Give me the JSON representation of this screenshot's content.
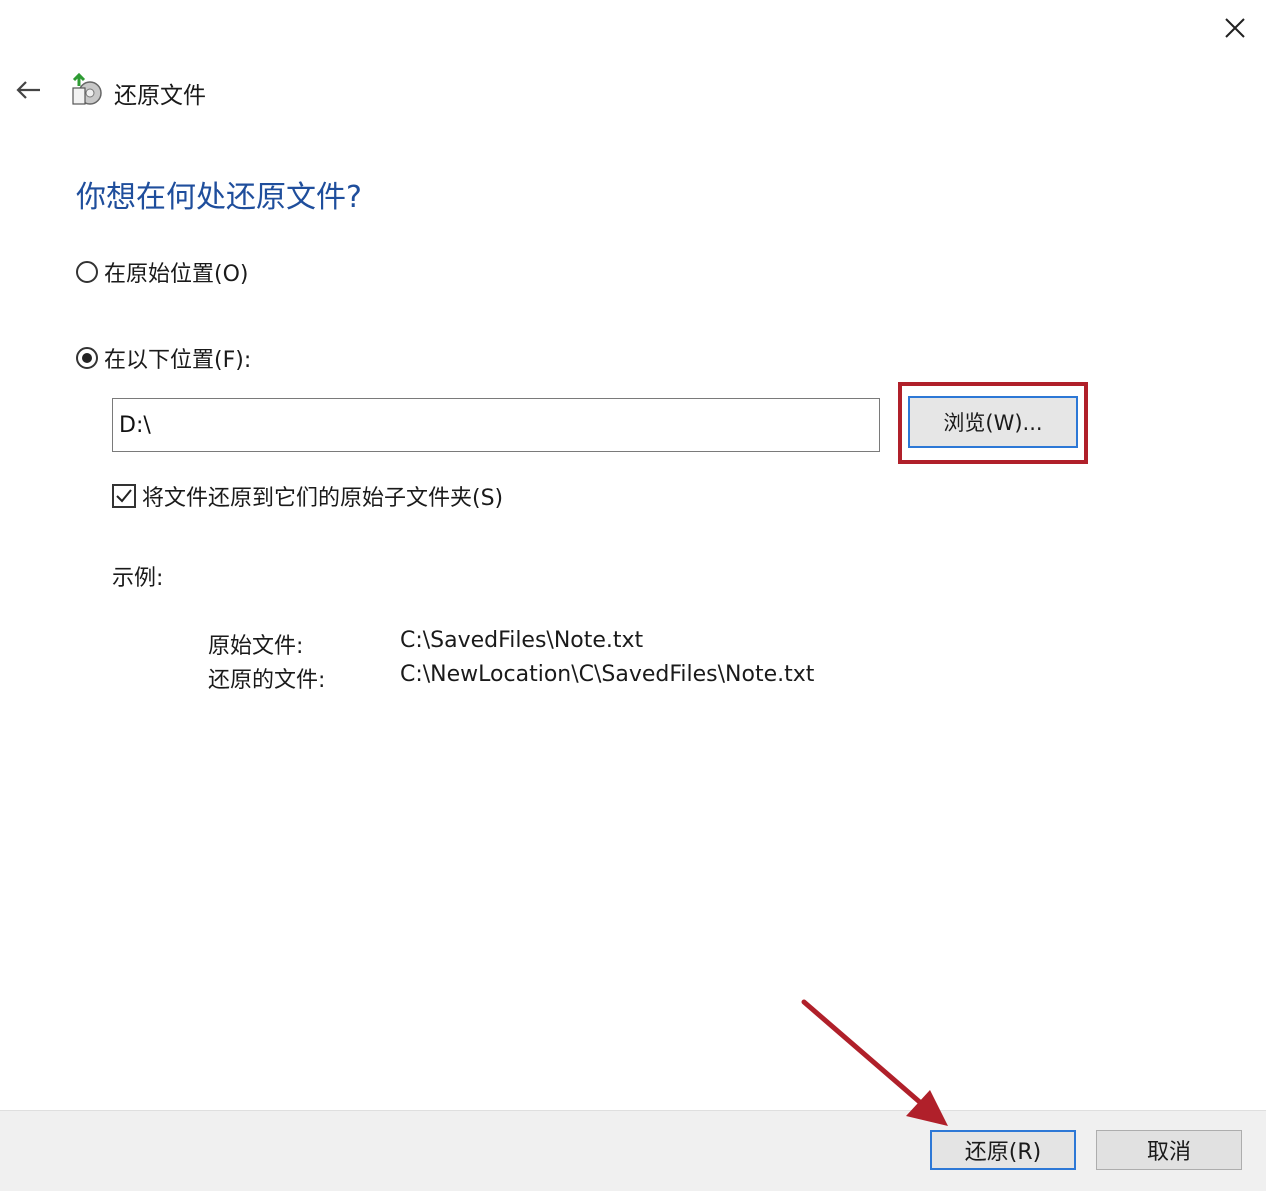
{
  "window": {
    "title": "还原文件"
  },
  "heading": "你想在何处还原文件?",
  "options": {
    "original_location": {
      "label": "在原始位置(O)",
      "selected": false
    },
    "following_location": {
      "label": "在以下位置(F):",
      "selected": true
    }
  },
  "path_input": {
    "value": "D:\\"
  },
  "browse_button": {
    "label": "浏览(W)..."
  },
  "subfolder_checkbox": {
    "label": "将文件还原到它们的原始子文件夹(S)",
    "checked": true
  },
  "example": {
    "label": "示例:",
    "rows": [
      {
        "key": "原始文件:",
        "value": "C:\\SavedFiles\\Note.txt"
      },
      {
        "key": "还原的文件:",
        "value": "C:\\NewLocation\\C\\SavedFiles\\Note.txt"
      }
    ]
  },
  "footer": {
    "restore_label": "还原(R)",
    "cancel_label": "取消"
  },
  "colors": {
    "heading": "#1f4e9c",
    "accent_border": "#2d78d6",
    "annotation": "#b0202a"
  },
  "icons": {
    "close": "close-icon",
    "back": "back-arrow-icon",
    "app": "restore-files-icon"
  }
}
